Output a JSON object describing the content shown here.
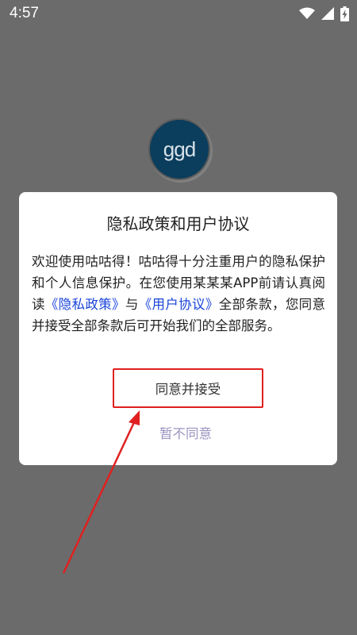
{
  "status_bar": {
    "time": "4:57",
    "icons": [
      "wifi-icon",
      "signal-icon",
      "battery-charging-icon"
    ]
  },
  "logo": {
    "text": "ggd"
  },
  "dialog": {
    "title": "隐私政策和用户协议",
    "body": {
      "intro": "欢迎使用咕咕得！咕咕得十分注重用户的隐私保护和个人信息保护。在您使用某某某APP前请认真阅读",
      "privacy_link": "《隐私政策》",
      "connector": "与",
      "terms_link": "《用户协议》",
      "outro": "全部条款，您同意并接受全部条款后可开始我们的全部服务。"
    },
    "agree_label": "同意并接受",
    "disagree_label": "暂不同意"
  },
  "colors": {
    "overlay": "#6b6b6b",
    "link": "#1a44d8",
    "annotation_red": "#e02020",
    "disagree": "#9a94c2",
    "logo_bg": "#0b3d5c"
  }
}
